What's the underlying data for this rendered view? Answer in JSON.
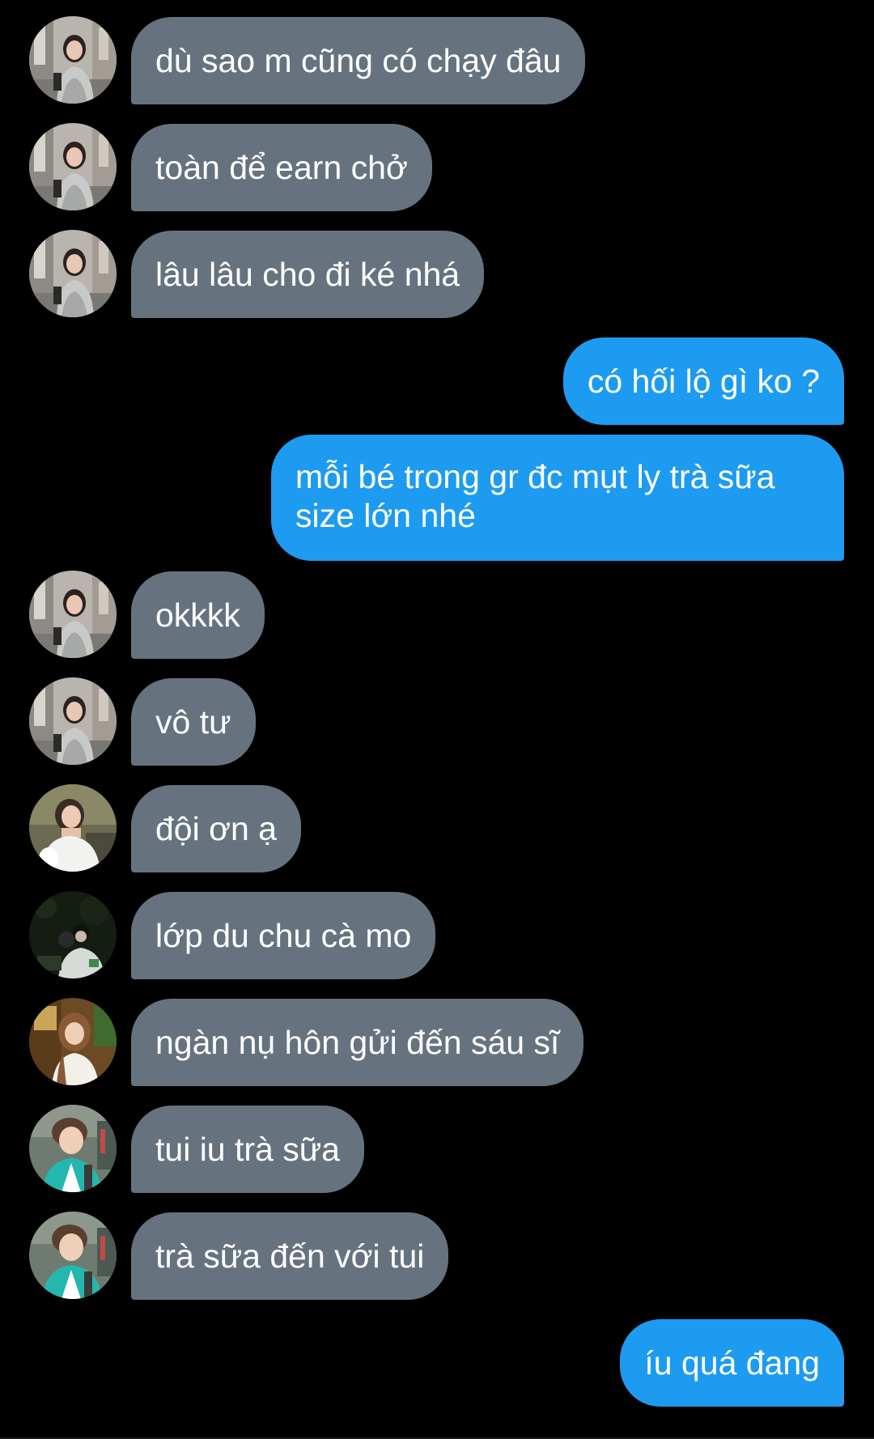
{
  "colors": {
    "background": "#000000",
    "incoming_bubble": "#66737f",
    "outgoing_bubble": "#1d9bf0",
    "text": "#ffffff"
  },
  "messages": [
    {
      "direction": "in",
      "avatar": "avatar-a",
      "text": "dù sao m cũng có chạy đâu"
    },
    {
      "direction": "in",
      "avatar": "avatar-a",
      "text": "toàn để earn chở"
    },
    {
      "direction": "in",
      "avatar": "avatar-a",
      "text": "lâu lâu cho đi ké nhá"
    },
    {
      "direction": "out",
      "text": "có hối lộ gì ko ?"
    },
    {
      "direction": "out",
      "text": "mỗi bé trong gr đc mụt ly trà sữa size lớn nhé"
    },
    {
      "direction": "in",
      "avatar": "avatar-a",
      "text": "okkkk"
    },
    {
      "direction": "in",
      "avatar": "avatar-a",
      "text": "vô tư"
    },
    {
      "direction": "in",
      "avatar": "avatar-b",
      "text": "đội ơn ạ"
    },
    {
      "direction": "in",
      "avatar": "avatar-c",
      "text": "lớp du chu cà mo"
    },
    {
      "direction": "in",
      "avatar": "avatar-d",
      "text": "ngàn nụ hôn gửi đến sáu sĩ"
    },
    {
      "direction": "in",
      "avatar": "avatar-e",
      "text": "tui iu trà sữa"
    },
    {
      "direction": "in",
      "avatar": "avatar-e",
      "text": "trà sữa đến với tui"
    },
    {
      "direction": "out",
      "text": "íu quá đang"
    }
  ]
}
